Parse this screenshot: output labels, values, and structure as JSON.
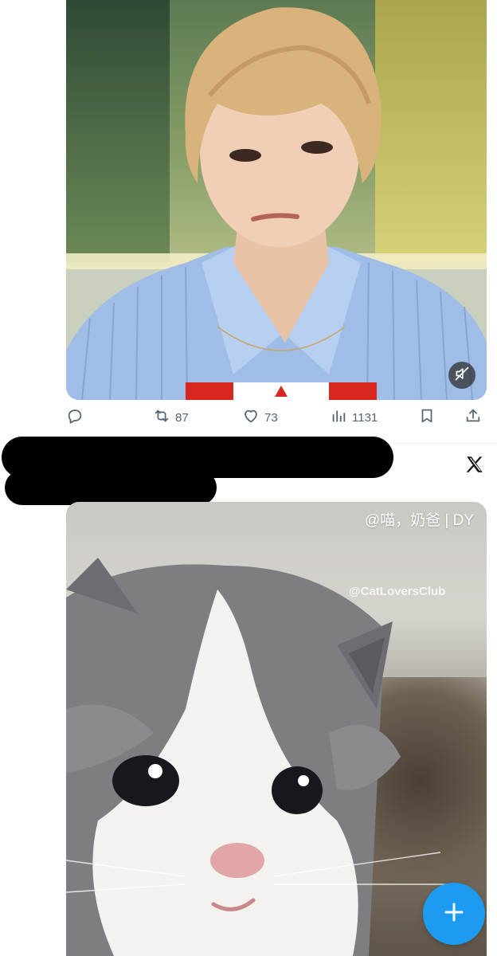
{
  "tweet1": {
    "actions": {
      "reply_icon": "reply-icon",
      "retweet_icon": "retweet-icon",
      "retweets": "87",
      "like_icon": "heart-icon",
      "likes": "73",
      "views_icon": "views-chart-icon",
      "views": "1131",
      "bookmark_icon": "bookmark-icon",
      "share_icon": "share-icon"
    },
    "media": {
      "mute_icon": "muted-speaker-icon"
    }
  },
  "tweet2": {
    "header": {
      "brand_icon": "x-logo-icon"
    },
    "media": {
      "watermark_top": "@喵，奶爸 | DY",
      "watermark_mid": "@CatLoversClub"
    }
  },
  "fab": {
    "icon": "plus-icon",
    "color": "#1d9bf0"
  },
  "colors": {
    "accent": "#1d9bf0",
    "muted_text": "#536471"
  }
}
